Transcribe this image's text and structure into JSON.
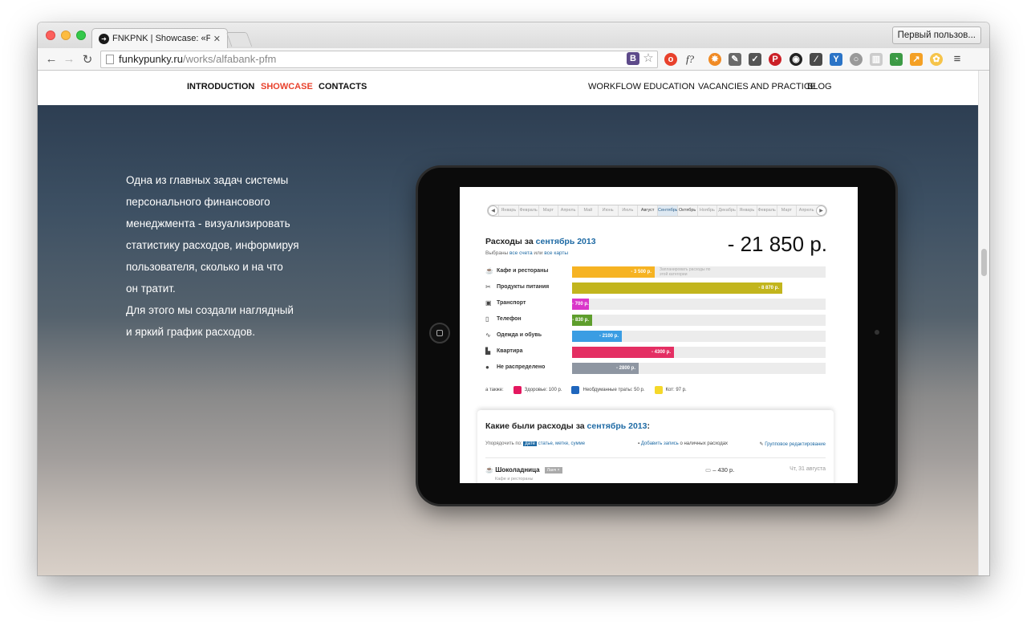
{
  "browser": {
    "tab_title": "FNKPNK | Showcase: «Рас",
    "profile": "Первый пользов...",
    "url_host": "funkypunky.ru",
    "url_path": "/works/alfabank-pfm",
    "ext_vk": "B",
    "ext_fq": "f?"
  },
  "site": {
    "nav_left": [
      "INTRODUCTION",
      "SHOWCASE",
      "CONTACTS"
    ],
    "nav_right": [
      "WORKFLOW",
      "EDUCATION",
      "VACANCIES AND PRACTICE",
      "BLOG"
    ],
    "active_color": "#e8412c"
  },
  "hero": {
    "lines": [
      "Одна из главных задач системы",
      "персонального финансового",
      "менеджмента - визуализировать",
      "статистику расходов, информируя",
      "пользователя, сколько и на что",
      "он тратит.",
      "Для этого мы создали наглядный",
      "и яркий график расходов."
    ]
  },
  "pfm": {
    "months": [
      "Январь",
      "Февраль",
      "Март",
      "Апрель",
      "Май",
      "Июнь",
      "Июль",
      "Август",
      "Сентябрь",
      "Октябрь",
      "Ноябрь",
      "Декабрь",
      "Январь",
      "Февраль",
      "Март",
      "Апрель"
    ],
    "title_prefix": "Расходы за",
    "title_month": "сентябрь 2013",
    "sub_prefix": "Выбраны",
    "sub_link1": "все счета",
    "sub_mid": "или",
    "sub_link2": "все карты",
    "total": "- 21 850 р.",
    "planned_note": "Запланировать расходы по этой категории",
    "categories": [
      {
        "label": "Кафе и рестораны",
        "amount": "- 3 500 р.",
        "value": 3500,
        "color": "#f6b323",
        "icon": "☕"
      },
      {
        "label": "Продукты питания",
        "amount": "- 8 870 р.",
        "value": 8870,
        "color": "#c2b51d",
        "icon": "✂"
      },
      {
        "label": "Транспорт",
        "amount": "- 700 р.",
        "value": 700,
        "color": "#d935c9",
        "icon": "▣"
      },
      {
        "label": "Телефон",
        "amount": "- 830 р.",
        "value": 830,
        "color": "#5e9e2c",
        "icon": "▯"
      },
      {
        "label": "Одежда и обувь",
        "amount": "- 2100 р.",
        "value": 2100,
        "color": "#3a9de3",
        "icon": "∿"
      },
      {
        "label": "Квартира",
        "amount": "- 4300 р.",
        "value": 4300,
        "color": "#e42f63",
        "icon": "▙"
      },
      {
        "label": "Не распределено",
        "amount": "- 2800 р.",
        "value": 2800,
        "color": "#8e96a2",
        "icon": "●"
      }
    ],
    "legend_prefix": "а также:",
    "legend": [
      {
        "label": "Здоровье: 100 р.",
        "color": "#e4175f"
      },
      {
        "label": "Необдуманные траты: 50 р.",
        "color": "#1f66bd"
      },
      {
        "label": "Кот: 97 р.",
        "color": "#f5d82a"
      }
    ],
    "section2_title_prefix": "Какие были расходы за",
    "section2_title_month": "сентябрь 2013",
    "section2_title_suffix": ":",
    "sort_prefix": "Упорядочить по:",
    "sort_selected": "дате",
    "sort_rest": "статье, метке, сумме",
    "add_link": "Добавить запись",
    "add_rest": "о наличных расходах",
    "group_edit": "Групповое редактирование",
    "entry_name": "Шоколадница",
    "entry_tag": "Ланч ×",
    "entry_category": "Кафе и рестораны",
    "entry_amount": "– 430 р.",
    "entry_date": "Чт, 31 августа"
  }
}
